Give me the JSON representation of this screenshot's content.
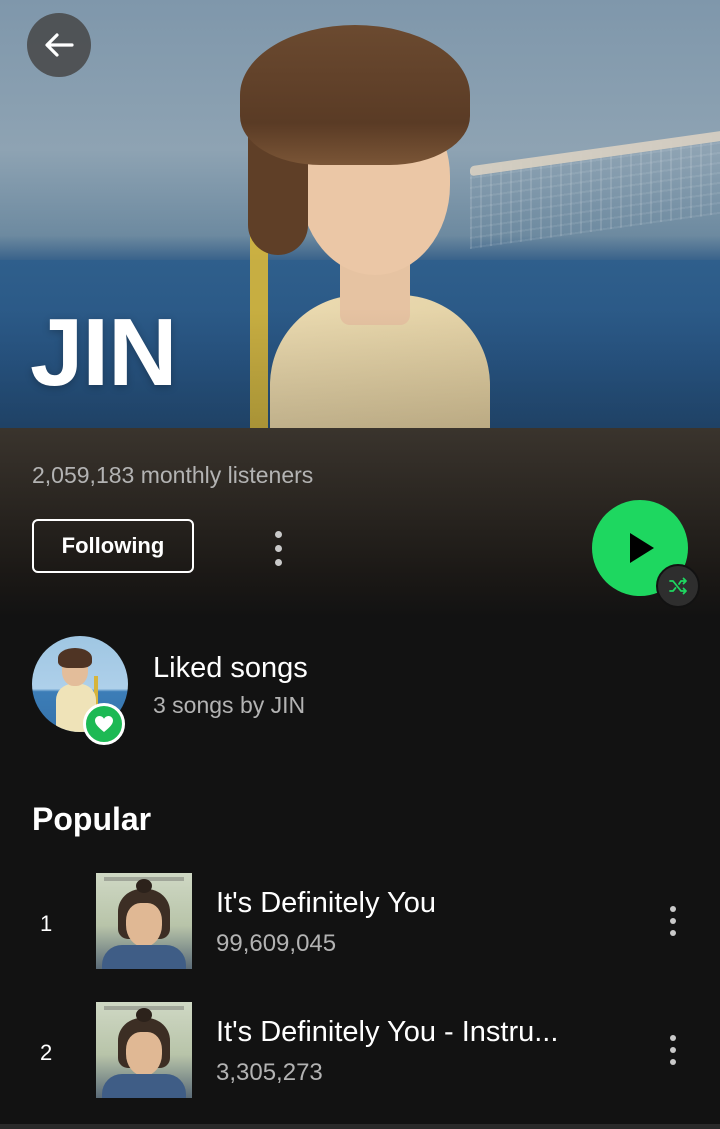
{
  "artist": {
    "name": "JIN",
    "monthly_listeners": "2,059,183 monthly listeners"
  },
  "actions": {
    "follow_label": "Following",
    "play_icon": "play-icon",
    "shuffle_icon": "shuffle-icon"
  },
  "liked": {
    "title": "Liked songs",
    "subtitle": "3 songs by JIN"
  },
  "popular": {
    "title": "Popular",
    "tracks": [
      {
        "rank": "1",
        "title": "It's Definitely You",
        "plays": "99,609,045"
      },
      {
        "rank": "2",
        "title": "It's Definitely You - Instru...",
        "plays": "3,305,273"
      }
    ]
  },
  "colors": {
    "accent": "#1ed760",
    "background": "#121212",
    "secondary_text": "#b3b3b3"
  }
}
